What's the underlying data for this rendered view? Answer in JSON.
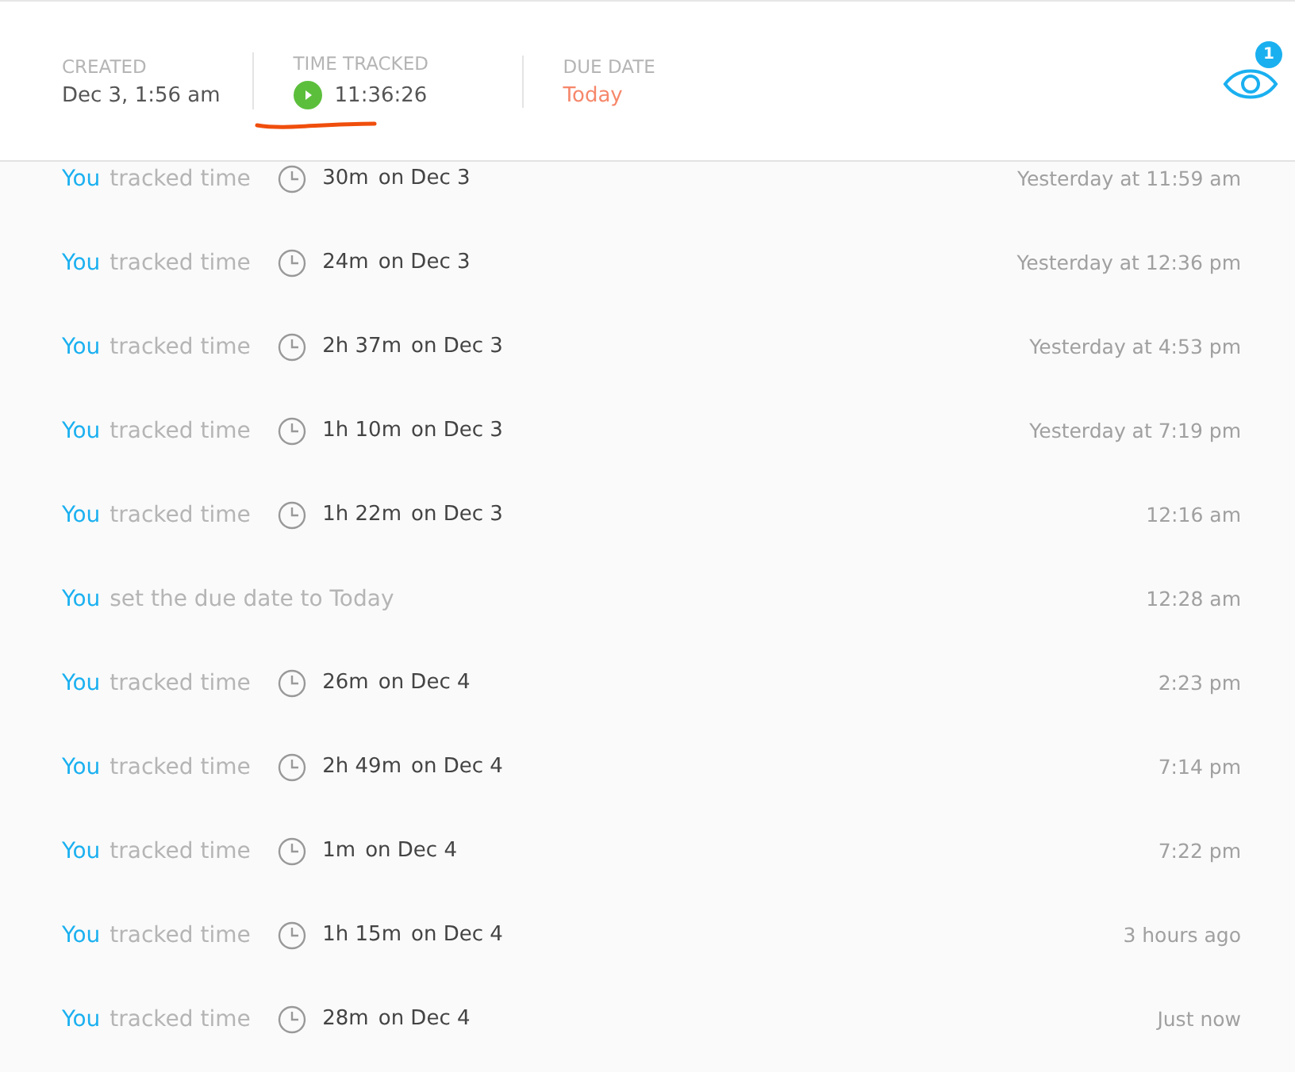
{
  "header": {
    "fields": [
      {
        "label": "CREATED",
        "value": "Dec 3, 1:56 am",
        "kind": "plain"
      },
      {
        "label": "TIME TRACKED",
        "value": "11:36:26",
        "kind": "timer",
        "running": true
      },
      {
        "label": "DUE DATE",
        "value": "Today",
        "kind": "due"
      }
    ],
    "watchers": {
      "count": "1"
    }
  },
  "activity": [
    {
      "kind": "time",
      "actor": "You",
      "action": "tracked time",
      "duration": "30m",
      "date": "on Dec 3",
      "time": "Yesterday at 11:59 am"
    },
    {
      "kind": "time",
      "actor": "You",
      "action": "tracked time",
      "duration": "24m",
      "date": "on Dec 3",
      "time": "Yesterday at 12:36 pm"
    },
    {
      "kind": "time",
      "actor": "You",
      "action": "tracked time",
      "duration": "2h 37m",
      "date": "on Dec 3",
      "time": "Yesterday at 4:53 pm"
    },
    {
      "kind": "time",
      "actor": "You",
      "action": "tracked time",
      "duration": "1h 10m",
      "date": "on Dec 3",
      "time": "Yesterday at 7:19 pm"
    },
    {
      "kind": "time",
      "actor": "You",
      "action": "tracked time",
      "duration": "1h 22m",
      "date": "on Dec 3",
      "time": "12:16 am"
    },
    {
      "kind": "due",
      "actor": "You",
      "action": "set the due date to Today",
      "time": "12:28 am"
    },
    {
      "kind": "time",
      "actor": "You",
      "action": "tracked time",
      "duration": "26m",
      "date": "on Dec 4",
      "time": "2:23 pm"
    },
    {
      "kind": "time",
      "actor": "You",
      "action": "tracked time",
      "duration": "2h 49m",
      "date": "on Dec 4",
      "time": "7:14 pm"
    },
    {
      "kind": "time",
      "actor": "You",
      "action": "tracked time",
      "duration": "1m",
      "date": "on Dec 4",
      "time": "7:22 pm"
    },
    {
      "kind": "time",
      "actor": "You",
      "action": "tracked time",
      "duration": "1h 15m",
      "date": "on Dec 4",
      "time": "3 hours ago"
    },
    {
      "kind": "time",
      "actor": "You",
      "action": "tracked time",
      "duration": "28m",
      "date": "on Dec 4",
      "time": "Just now"
    }
  ]
}
